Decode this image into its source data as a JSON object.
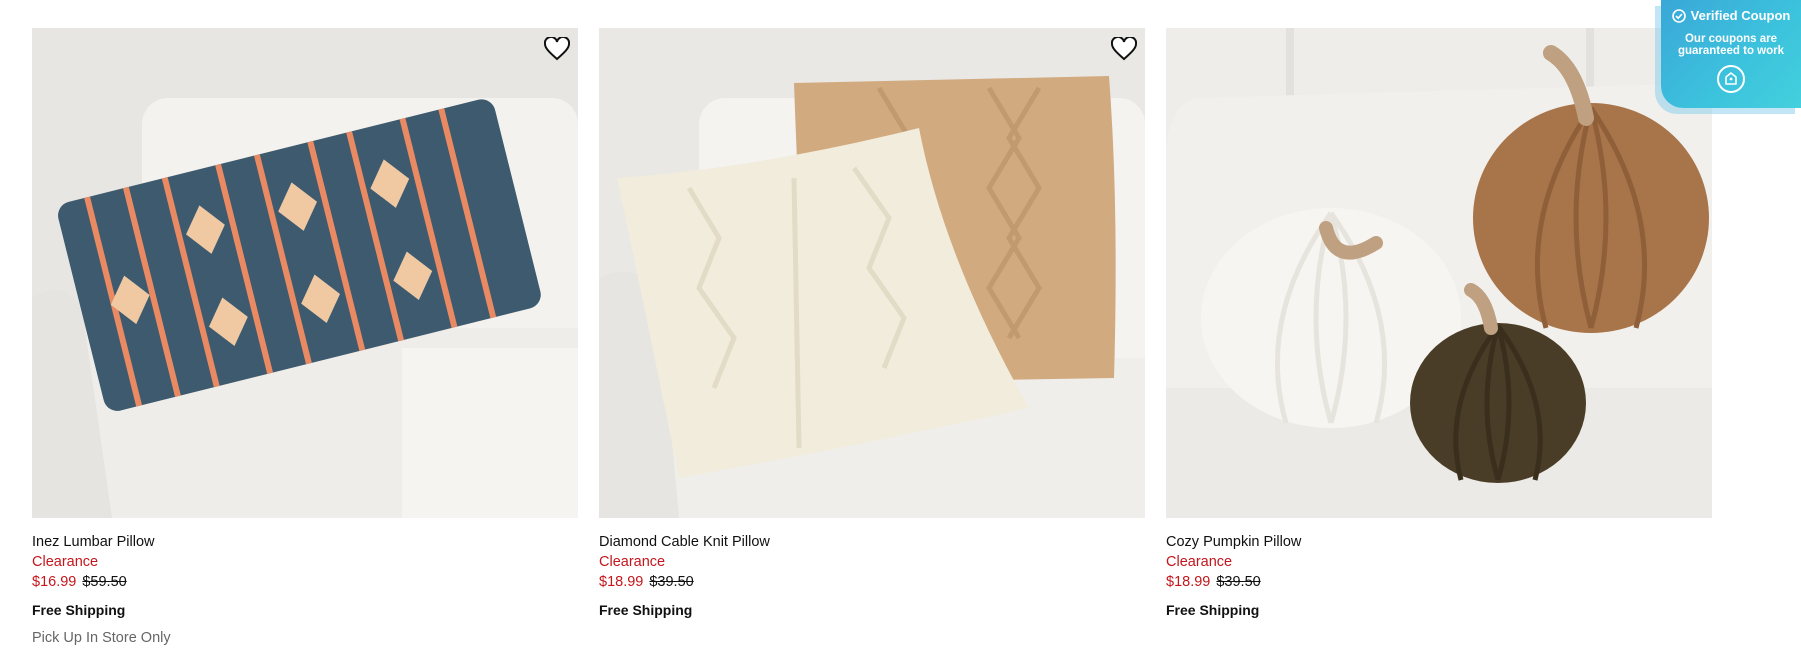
{
  "products": [
    {
      "name": "Inez Lumbar Pillow",
      "badge": "Clearance",
      "sale_price": "$16.99",
      "original_price": "$59.50",
      "shipping": "Free Shipping",
      "pickup": "Pick Up In Store Only",
      "favorite_icon": "heart-outline-icon"
    },
    {
      "name": "Diamond Cable Knit Pillow",
      "badge": "Clearance",
      "sale_price": "$18.99",
      "original_price": "$39.50",
      "shipping": "Free Shipping",
      "favorite_icon": "heart-outline-icon"
    },
    {
      "name": "Cozy Pumpkin Pillow",
      "badge": "Clearance",
      "sale_price": "$18.99",
      "original_price": "$39.50",
      "shipping": "Free Shipping"
    }
  ],
  "coupon": {
    "title": "Verified Coupon",
    "subtitle": "Our coupons are guaranteed to work",
    "icon": "coupon-icon"
  },
  "colors": {
    "sale_red": "#c4161c",
    "coupon_blue": "#3aa7d8"
  }
}
